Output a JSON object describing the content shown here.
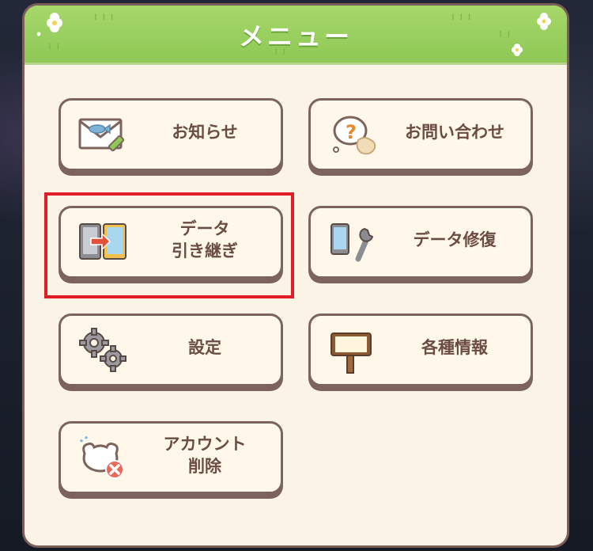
{
  "menu": {
    "title": "メニュー",
    "buttons": {
      "news": "お知らせ",
      "contact": "お問い合わせ",
      "transfer_line1": "データ",
      "transfer_line2": "引き継ぎ",
      "repair": "データ修復",
      "settings": "設定",
      "info": "各種情報",
      "delete_line1": "アカウント",
      "delete_line2": "削除"
    }
  },
  "colors": {
    "header_green": "#8ec855",
    "panel_bg": "#fbf4e6",
    "button_border": "#7c645d",
    "label_text": "#6b4c44",
    "highlight_red": "#e21c25"
  },
  "icons": {
    "news": "envelope-fish-icon",
    "contact": "question-bubble-icon",
    "transfer": "phone-transfer-icon",
    "repair": "phone-wrench-icon",
    "settings": "gears-icon",
    "info": "signboard-icon",
    "delete": "account-delete-icon"
  }
}
